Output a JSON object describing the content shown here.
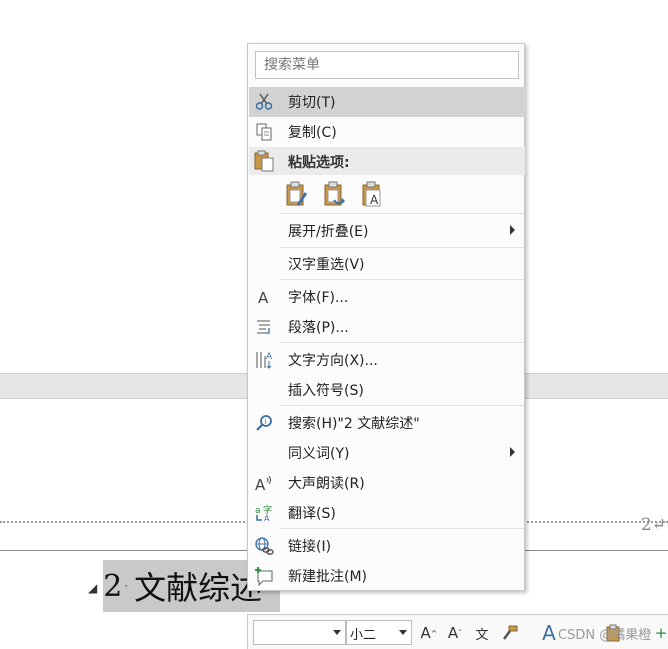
{
  "document": {
    "page_number": "2",
    "return_mark": "↵",
    "heading_number": "2",
    "heading_text": "文献综述"
  },
  "context_menu": {
    "search_placeholder": "搜索菜单",
    "paste_header": "粘贴选项:",
    "items": {
      "cut": "剪切(T)",
      "copy": "复制(C)",
      "expand": "展开/折叠(E)",
      "reconvert": "汉字重选(V)",
      "font": "字体(F)...",
      "paragraph": "段落(P)...",
      "text_direction": "文字方向(X)...",
      "insert_symbol": "插入符号(S)",
      "search": "搜索(H)\"2 文献综述\"",
      "synonyms": "同义词(Y)",
      "read_aloud": "大声朗读(R)",
      "translate": "翻译(S)",
      "link": "链接(I)",
      "new_comment": "新建批注(M)"
    }
  },
  "mini_toolbar": {
    "font_name": "",
    "font_size": "小二"
  },
  "watermark": "CSDN @橘果橙"
}
